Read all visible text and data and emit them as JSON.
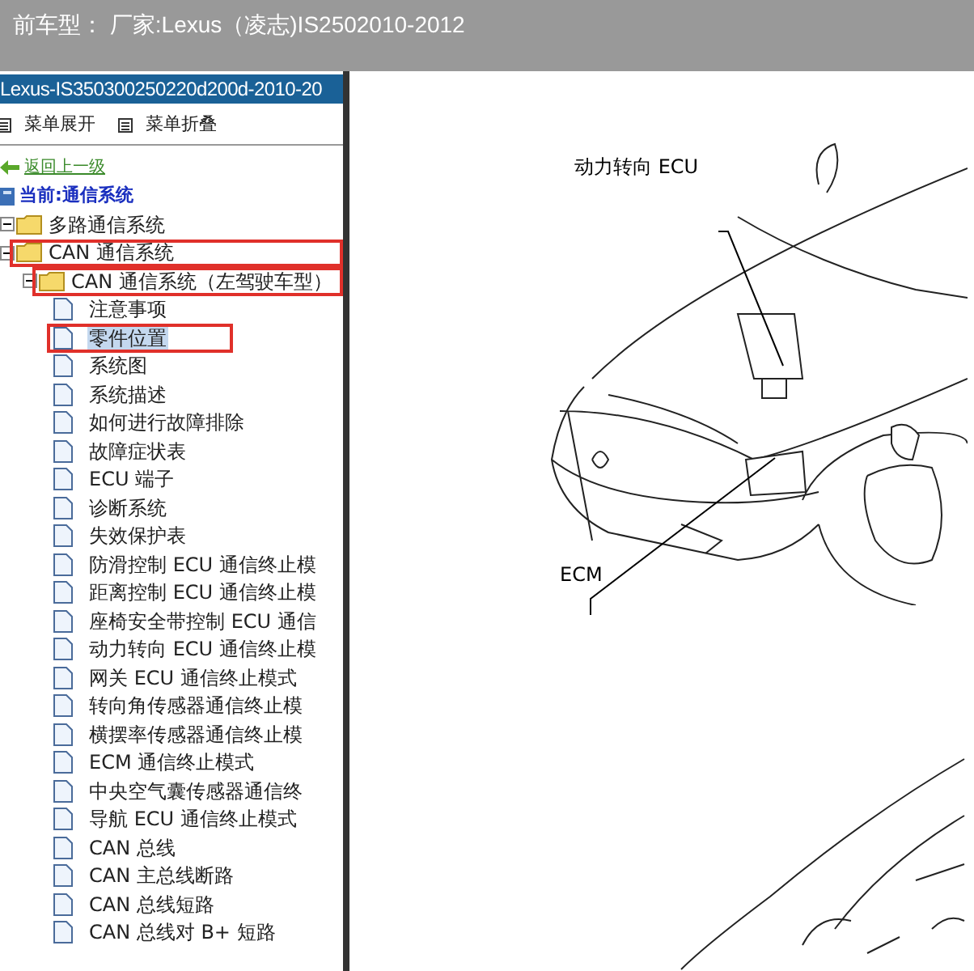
{
  "top_bar": {
    "title": "前车型： 厂家:Lexus（凌志)IS2502010-2012"
  },
  "left_panel": {
    "title": "Lexus-IS350300250220d200d-2010-20",
    "menu": [
      {
        "label": "菜单展开"
      },
      {
        "label": "菜单折叠"
      }
    ],
    "back_link": "返回上一级",
    "current": "当前:通信系统",
    "tree": [
      {
        "kind": "folder",
        "label": "多路通信系统",
        "expanded": true
      },
      {
        "kind": "folder",
        "label": "CAN 通信系统",
        "expanded": true,
        "boxed": true,
        "children": [
          {
            "kind": "folder",
            "label": "CAN 通信系统（左驾驶车型）",
            "expanded": true,
            "boxed": true,
            "children": [
              {
                "label": "注意事项",
                "selected": false
              },
              {
                "label": "零件位置",
                "selected": true,
                "boxed": true
              },
              {
                "label": "系统图",
                "selected": false
              },
              {
                "label": "系统描述",
                "selected": false
              },
              {
                "label": "如何进行故障排除",
                "selected": false
              },
              {
                "label": "故障症状表",
                "selected": false
              },
              {
                "label": "ECU 端子",
                "selected": false
              },
              {
                "label": "诊断系统",
                "selected": false
              },
              {
                "label": "失效保护表",
                "selected": false
              },
              {
                "label": "防滑控制 ECU 通信终止模",
                "selected": false
              },
              {
                "label": "距离控制 ECU 通信终止模",
                "selected": false
              },
              {
                "label": "座椅安全带控制 ECU 通信",
                "selected": false
              },
              {
                "label": "动力转向 ECU 通信终止模",
                "selected": false
              },
              {
                "label": "网关 ECU 通信终止模式",
                "selected": false
              },
              {
                "label": "转向角传感器通信终止模",
                "selected": false
              },
              {
                "label": "横摆率传感器通信终止模",
                "selected": false
              },
              {
                "label": "ECM 通信终止模式",
                "selected": false
              },
              {
                "label": "中央空气囊传感器通信终",
                "selected": false
              },
              {
                "label": "导航 ECU 通信终止模式",
                "selected": false
              },
              {
                "label": "CAN 总线",
                "selected": false
              },
              {
                "label": "CAN 主总线断路",
                "selected": false
              },
              {
                "label": "CAN 总线短路",
                "selected": false
              },
              {
                "label": "CAN 总线对 B+ 短路",
                "selected": false
              }
            ]
          }
        ]
      }
    ]
  },
  "diagram": {
    "labels": [
      "动力转向 ECU",
      "ECM"
    ]
  }
}
